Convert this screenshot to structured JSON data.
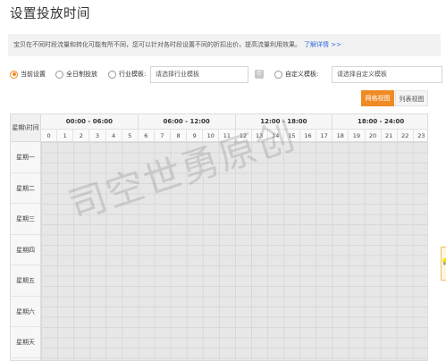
{
  "title": "设置投放时间",
  "notice": {
    "text": "宝贝在不同时段流量和转化可能有所不同，您可以针对各时段设置不同的折扣出价，提高流量利用效果。",
    "link": "了解详情 >>"
  },
  "options": {
    "current": "当前设置",
    "all_day": "全日制投放",
    "industry": "行业模板:",
    "industry_placeholder": "请选择行业模板",
    "custom": "自定义模板:",
    "custom_placeholder": "请选择自定义模板",
    "square_glyph": "存"
  },
  "views": {
    "grid": "网格视图",
    "list": "列表视图"
  },
  "table": {
    "corner": "星期\\时间",
    "ranges": [
      "00:00 - 06:00",
      "06:00 - 12:00",
      "12:00 - 18:00",
      "18:00 - 24:00"
    ],
    "hours": [
      "0",
      "1",
      "2",
      "3",
      "4",
      "5",
      "6",
      "7",
      "8",
      "9",
      "10",
      "11",
      "12",
      "13",
      "14",
      "15",
      "16",
      "17",
      "18",
      "19",
      "20",
      "21",
      "22",
      "23"
    ],
    "days": [
      "星期一",
      "星期二",
      "星期三",
      "星期四",
      "星期五",
      "星期六",
      "星期天"
    ]
  },
  "watermark": "司空世勇原创",
  "colors": {
    "accent": "#f08a24",
    "link": "#2d6cdf",
    "cell": "#e7e7e7"
  }
}
